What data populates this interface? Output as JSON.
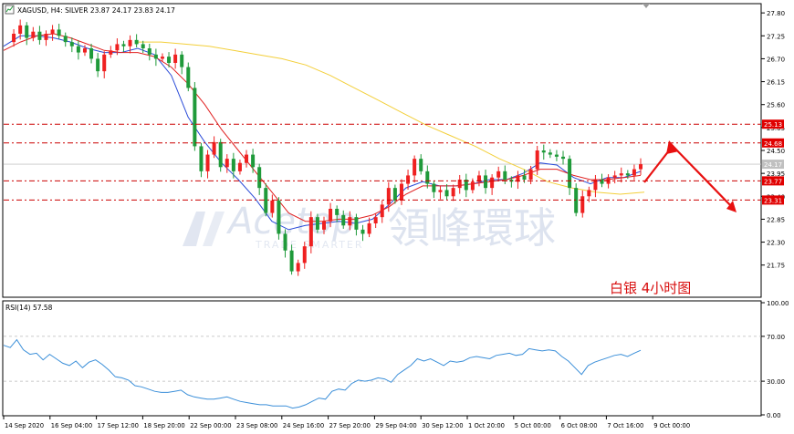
{
  "header": {
    "symbol_line": "XAGUSD, H4:  SILVER  23.87 24.17 23.83 24.17"
  },
  "annotation": "白银  4小时图",
  "watermark": {
    "brand": "Acetop",
    "tagline": "TRADE SMARTER",
    "chinese": "領峰環球"
  },
  "colors": {
    "bull": "#ef2020",
    "bear": "#1f9a3a",
    "ma_fast": "#2a4bd8",
    "ma_mid": "#e02020",
    "ma_slow": "#f3cf3a",
    "rsi": "#3b8fd9",
    "level_line": "#cc0000",
    "label_bg": "#e00000",
    "arrow": "#e81010",
    "annotation": "#d81010"
  },
  "chart_data": [
    {
      "type": "candlestick",
      "title": "XAGUSD, H4:  SILVER  23.87 24.17 23.83 24.17",
      "ylim": [
        21.0,
        28.0
      ],
      "y_ticks": [
        "27.80",
        "27.25",
        "26.70",
        "26.15",
        "25.60",
        "25.05",
        "24.50",
        "23.95",
        "23.40",
        "22.85",
        "22.30",
        "21.75"
      ],
      "x_labels": [
        "14 Sep 2020",
        "16 Sep 04:00",
        "17 Sep 12:00",
        "18 Sep 20:00",
        "22 Sep 00:00",
        "23 Sep 08:00",
        "24 Sep 16:00",
        "27 Sep 20:00",
        "29 Sep 04:00",
        "30 Sep 12:00",
        "1 Oct 20:00",
        "5 Oct 00:00",
        "6 Oct 08:00",
        "7 Oct 16:00",
        "9 Oct 00:00"
      ],
      "levels": [
        {
          "value": 25.13,
          "label": "25.13"
        },
        {
          "value": 24.68,
          "label": "24.68"
        },
        {
          "value": 23.77,
          "label": "23.77"
        },
        {
          "value": 23.31,
          "label": "23.31"
        }
      ],
      "current_price": {
        "value": 24.17,
        "label": "24.17"
      },
      "close_series": [
        27.1,
        27.3,
        27.5,
        27.2,
        27.35,
        27.15,
        27.3,
        27.4,
        27.25,
        27.1,
        27.0,
        26.85,
        26.95,
        26.7,
        26.4,
        26.8,
        26.9,
        27.05,
        27.0,
        27.15,
        27.05,
        26.95,
        26.8,
        26.7,
        26.75,
        26.6,
        26.8,
        26.5,
        26.0,
        24.6,
        24.0,
        24.4,
        24.7,
        24.1,
        24.3,
        24.0,
        24.2,
        24.4,
        24.1,
        23.6,
        23.0,
        23.3,
        22.5,
        22.1,
        21.6,
        21.8,
        22.2,
        22.9,
        22.6,
        22.8,
        23.1,
        22.95,
        22.7,
        22.9,
        22.6,
        22.5,
        22.75,
        22.9,
        23.2,
        23.6,
        23.3,
        23.7,
        23.9,
        24.3,
        24.0,
        23.7,
        23.5,
        23.55,
        23.4,
        23.6,
        23.8,
        23.55,
        23.75,
        23.9,
        23.6,
        23.85,
        24.0,
        23.8,
        23.75,
        23.9,
        23.8,
        24.05,
        24.5,
        24.45,
        24.4,
        24.35,
        24.3,
        23.6,
        23.0,
        23.4,
        23.55,
        23.8,
        23.7,
        23.85,
        23.9,
        23.95,
        23.9,
        24.05,
        24.17
      ],
      "moving_averages": [
        {
          "period_hint": "fast",
          "values": [
            27.0,
            27.25,
            27.25,
            27.2,
            27.1,
            26.95,
            26.85,
            26.85,
            26.95,
            26.8,
            26.3,
            25.3,
            24.7,
            24.2,
            23.8,
            23.35,
            22.8,
            22.6,
            22.7,
            22.75,
            22.8,
            22.75,
            22.85,
            23.2,
            23.6,
            23.75,
            23.65,
            23.65,
            23.7,
            23.8,
            23.8,
            23.95,
            24.2,
            24.15,
            23.85,
            23.7,
            23.85,
            23.85,
            24.0
          ]
        },
        {
          "period_hint": "mid",
          "values": [
            26.9,
            27.1,
            27.25,
            27.3,
            27.2,
            27.05,
            26.9,
            26.85,
            26.85,
            26.75,
            26.5,
            26.1,
            25.6,
            25.0,
            24.5,
            24.0,
            23.5,
            23.0,
            22.8,
            22.8,
            22.85,
            22.85,
            22.95,
            23.15,
            23.45,
            23.65,
            23.65,
            23.65,
            23.7,
            23.75,
            23.8,
            23.9,
            24.05,
            24.05,
            23.9,
            23.8,
            23.8,
            23.85,
            23.9
          ]
        },
        {
          "period_hint": "slow",
          "values": [
            27.1,
            27.1,
            27.05,
            27.0,
            26.9,
            26.8,
            26.7,
            26.55,
            26.3,
            26.0,
            25.7,
            25.4,
            25.1,
            24.85,
            24.6,
            24.3,
            24.05,
            23.75,
            23.6,
            23.5,
            23.45,
            23.5
          ]
        }
      ]
    },
    {
      "type": "line",
      "title": "RSI(14) 57.58",
      "ylim": [
        0,
        100
      ],
      "y_ticks": [
        "100.00",
        "70.00",
        "30.00",
        "0.00"
      ],
      "values": [
        62,
        60,
        67,
        58,
        54,
        55,
        49,
        54,
        50,
        46,
        44,
        48,
        42,
        47,
        49,
        45,
        40,
        34,
        33,
        31,
        26,
        25,
        23,
        21,
        20,
        20,
        21,
        22,
        18,
        16,
        15,
        14,
        14,
        15,
        16,
        14,
        12,
        11,
        10,
        9,
        9,
        8,
        8,
        8,
        6,
        7,
        9,
        12,
        15,
        14,
        21,
        23,
        22,
        28,
        31,
        30,
        31,
        33,
        32,
        29,
        36,
        40,
        44,
        50,
        48,
        50,
        47,
        44,
        48,
        47,
        48,
        51,
        52,
        51,
        50,
        53,
        54,
        55,
        53,
        54,
        59,
        58,
        57,
        58,
        57,
        52,
        48,
        42,
        36,
        44,
        47,
        49,
        51,
        53,
        54,
        52,
        55,
        57.58
      ]
    }
  ]
}
